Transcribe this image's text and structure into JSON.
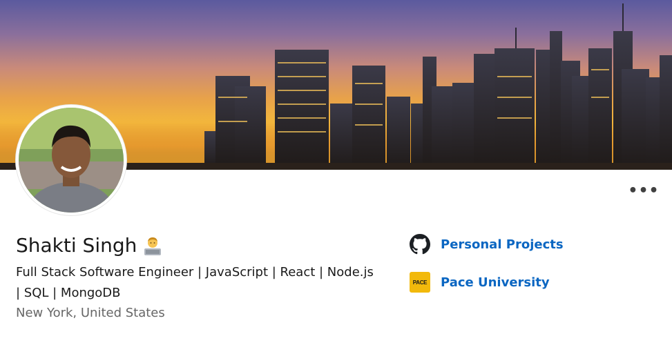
{
  "profile": {
    "name": "Shakti Singh",
    "headline": "Full Stack Software Engineer | JavaScript | React | Node.js | SQL | MongoDB",
    "location": "New York, United States",
    "more_label": "•••"
  },
  "links": [
    {
      "label": "Personal Projects",
      "icon": "github-icon"
    },
    {
      "label": "Pace University",
      "icon": "pace-university-logo",
      "logo_text": "PACE"
    }
  ],
  "colors": {
    "link": "#0a66c2",
    "pace_logo": "#f2b90c"
  }
}
